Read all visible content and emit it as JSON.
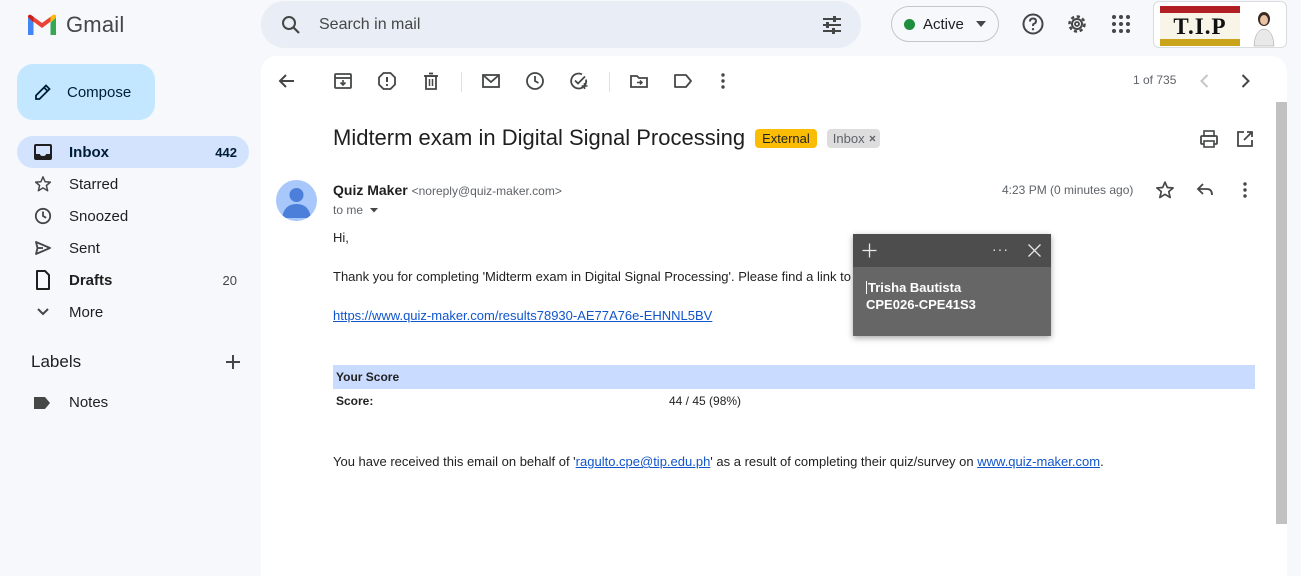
{
  "app": {
    "name": "Gmail"
  },
  "search": {
    "placeholder": "Search in mail"
  },
  "status": {
    "label": "Active",
    "color": "#1e8e3e"
  },
  "header_icons": [
    "search-icon",
    "tune-icon",
    "help-icon",
    "settings-icon",
    "apps-grid-icon"
  ],
  "account": {
    "logo_text": "TIP"
  },
  "compose": {
    "label": "Compose"
  },
  "nav": [
    {
      "label": "Inbox",
      "count": "442",
      "icon": "inbox-icon"
    },
    {
      "label": "Starred",
      "count": "",
      "icon": "star-icon"
    },
    {
      "label": "Snoozed",
      "count": "",
      "icon": "clock-icon"
    },
    {
      "label": "Sent",
      "count": "",
      "icon": "send-icon"
    },
    {
      "label": "Drafts",
      "count": "20",
      "icon": "draft-icon"
    },
    {
      "label": "More",
      "count": "",
      "icon": "chevron-down-icon"
    }
  ],
  "labels": {
    "title": "Labels",
    "items": [
      {
        "label": "Notes",
        "icon": "label-icon"
      }
    ]
  },
  "toolbar": {
    "icons": [
      "back-arrow-icon",
      "archive-icon",
      "report-spam-icon",
      "delete-icon",
      "mark-unread-icon",
      "snooze-icon",
      "add-task-icon",
      "move-to-icon",
      "label-icon",
      "more-vert-icon"
    ],
    "pager": "1 of 735"
  },
  "email": {
    "subject": "Midterm exam in Digital Signal Processing",
    "badges": {
      "external": "External",
      "inbox": "Inbox"
    },
    "sender_name": "Quiz Maker",
    "sender_email": "<noreply@quiz-maker.com>",
    "to": "to me",
    "time": "4:23 PM (0 minutes ago)",
    "greeting": "Hi,",
    "thank_you": "Thank you for completing 'Midterm exam in Digital Signal Processing'. Please find a link to",
    "result_link": "https://www.quiz-maker.com/results78930-AE77A76e-EHNNL5BV",
    "score_header": "Your Score",
    "score_label": "Score:",
    "score_value": "44 / 45 (98%)",
    "footer_prefix": "You have received this email on behalf of '",
    "footer_email": "ragulto.cpe@tip.edu.ph",
    "footer_middle": "' as a result of completing their quiz/survey on ",
    "footer_site": "www.quiz-maker.com",
    "footer_suffix": "."
  },
  "sticky_note": {
    "line1": "Trisha Bautista",
    "line2": "CPE026-CPE41S3",
    "dots": "···"
  }
}
